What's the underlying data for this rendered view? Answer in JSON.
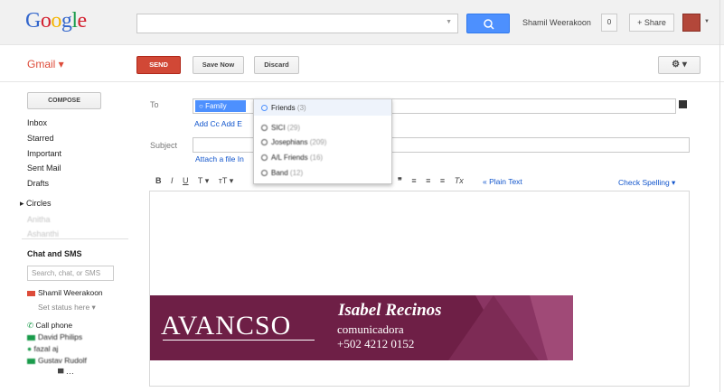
{
  "header": {
    "logo": "Google",
    "user_name": "Shamil Weerakoon",
    "notification_count": "0",
    "share_label": "+ Share"
  },
  "toolbar": {
    "app_label": "Gmail ▾",
    "send_label": "SEND",
    "save_label": "Save Now",
    "discard_label": "Discard",
    "settings_label": "⚙ ▾"
  },
  "sidebar": {
    "compose_label": "COMPOSE",
    "items": [
      "Inbox",
      "Starred",
      "Important",
      "Sent Mail",
      "Drafts"
    ],
    "circles_label": "▸ Circles",
    "circle_items": [
      "Anitha",
      "Ashanthi"
    ],
    "chat_title": "Chat and SMS",
    "chat_search_placeholder": "Search, chat, or SMS",
    "chat_user": "Shamil Weerakoon",
    "status": "Set status here ▾",
    "call_phone": "Call phone",
    "contacts": [
      "David Philips",
      "fazal aj",
      "Gustav Rudolf"
    ]
  },
  "compose": {
    "to_label": "To",
    "to_chip": "Family",
    "add_cc": "Add Cc",
    "add_e": "Add E",
    "subject_label": "Subject",
    "attach": "Attach a file",
    "attach_more": "In",
    "plain_text": "« Plain Text",
    "check_spelling": "Check Spelling ▾"
  },
  "dropdown": {
    "items": [
      {
        "label": "Friends",
        "count": "(3)"
      },
      {
        "label": "SICI",
        "count": "(29)"
      },
      {
        "label": "Josephians",
        "count": "(209)"
      },
      {
        "label": "A/L Friends",
        "count": "(16)"
      },
      {
        "label": "Band",
        "count": "(12)"
      }
    ]
  },
  "signature": {
    "brand": "AVANCSO",
    "name": "Isabel Recinos",
    "role": "comunicadora",
    "phone": "+502  4212 0152"
  }
}
